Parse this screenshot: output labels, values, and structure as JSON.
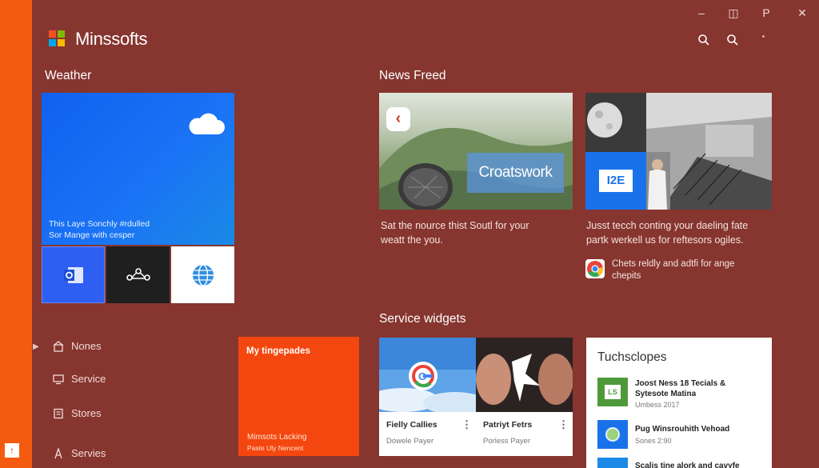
{
  "app": {
    "title": "Minssofts",
    "logo_colors": [
      "#f25022",
      "#7fba00",
      "#00a4ef",
      "#ffb900"
    ],
    "strip_button": "↑"
  },
  "window_controls": [
    "–",
    "◫",
    "P",
    "✕"
  ],
  "header_icons": [
    "search-icon",
    "search-icon",
    "more-icon"
  ],
  "weather": {
    "heading": "Weather",
    "tile_line1": "This Laye Sonchly #rdulled",
    "tile_line2": "Sor Mange with cesper",
    "tiles": [
      "outlook-icon",
      "connect-icon",
      "globe-icon"
    ]
  },
  "nav": [
    {
      "label": "Nones",
      "icon": "home-icon"
    },
    {
      "label": "Service",
      "icon": "monitor-icon"
    },
    {
      "label": "Stores",
      "icon": "store-icon"
    },
    {
      "label": "Servies",
      "icon": "pen-icon"
    }
  ],
  "orange_tile": {
    "title": "My tingepades",
    "line1": "Mimsots Lacking",
    "line2": "Paste Uly Nencent"
  },
  "news": {
    "heading": "News Freed",
    "card1": {
      "overlay": "Croatswork",
      "line1": "Sat the nource thist Soutl for your",
      "line2": "weatt the you."
    },
    "card2": {
      "badge": "I2E",
      "line1": "Jusst tecch conting your daeling fate",
      "line2": "partk werkell us for reftesors ogiles.",
      "sub1": "Chets reldly and adtfi for ange",
      "sub2": "chepits"
    }
  },
  "widgets": {
    "heading": "Service widgets",
    "cards": [
      {
        "title": "Fielly Callies",
        "sub": "Dowele Payer"
      },
      {
        "title": "Patriyt Fetrs",
        "sub": "Porless Payer"
      }
    ],
    "badge_letter": "G"
  },
  "touch": {
    "title": "Tuchsclopes",
    "items": [
      {
        "t1": "Joost Ness 18 Tecials &",
        "t2": "Sytesote Matina",
        "sub": "Umbess 2017"
      },
      {
        "t1": "Pug Winsrouhith Vehoad",
        "t2": "",
        "sub": "Sones 2:90"
      },
      {
        "t1": "Scalis tine alork and cavyfe",
        "t2": "",
        "sub": ""
      }
    ]
  }
}
